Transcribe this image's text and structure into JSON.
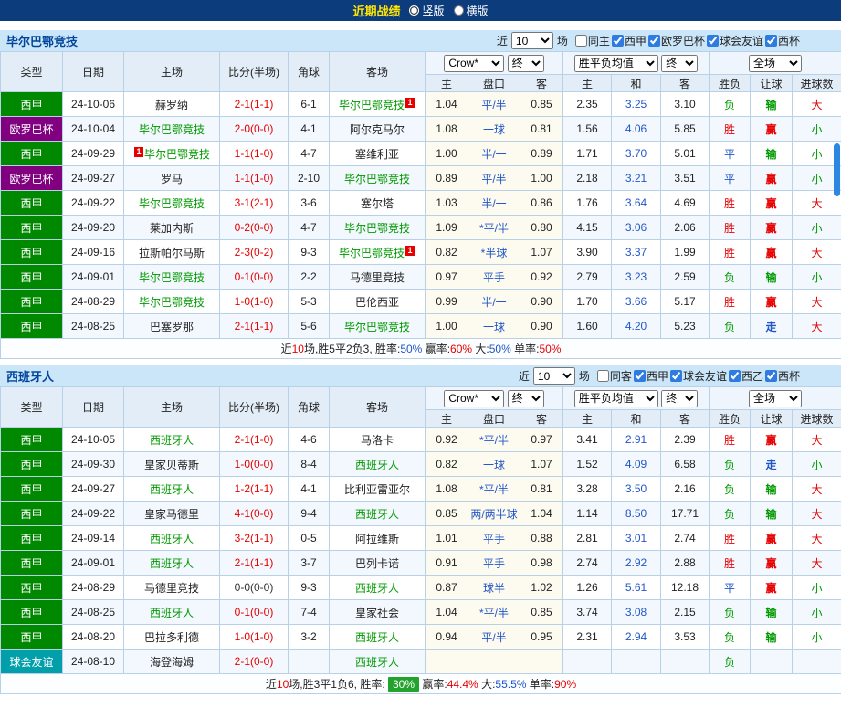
{
  "colors": {
    "topbar": "#0d3c7d",
    "section_bg": "#cbe5f9",
    "accent": "#2e7ce0",
    "red": "#e60000",
    "green": "#009900",
    "blue": "#2156c8",
    "liga": "#008800",
    "uefa": "#800080",
    "friendly": "#009faa",
    "sum_badge": "#22a32c",
    "thumb": "#2b87e0"
  },
  "topbar": {
    "title": "近期战绩",
    "options": [
      {
        "label": "竖版",
        "selected": true
      },
      {
        "label": "横版",
        "selected": false
      }
    ]
  },
  "sections": [
    {
      "team": "毕尔巴鄂竞技",
      "near": {
        "prefix": "近",
        "value": "10",
        "suffix": "场"
      },
      "filters": [
        {
          "label": "同主",
          "checked": false
        },
        {
          "label": "西甲",
          "checked": true
        },
        {
          "label": "欧罗巴杯",
          "checked": true
        },
        {
          "label": "球会友谊",
          "checked": true
        },
        {
          "label": "西杯",
          "checked": true
        }
      ],
      "selects": {
        "odds_source": "Crow*",
        "odds_period": "终",
        "wdl_source": "胜平负均值",
        "wdl_period": "终",
        "scope": "全场"
      },
      "columns": {
        "left": [
          "类型",
          "日期",
          "主场",
          "比分(半场)",
          "角球",
          "客场"
        ],
        "odds": [
          "主",
          "盘口",
          "客"
        ],
        "wdl": [
          "主",
          "和",
          "客"
        ],
        "result": [
          "胜负",
          "让球",
          "进球数"
        ]
      },
      "rows": [
        {
          "league": "西甲",
          "league_class": "liga",
          "date": "24-10-06",
          "home": "赫罗纳",
          "home_team": false,
          "score": "2-1(1-1)",
          "corners": "6-1",
          "away": "毕尔巴鄂竞技",
          "away_team": true,
          "away_badge": "1",
          "away_badge_side": "right",
          "odds_home": "1.04",
          "handicap": "平/半",
          "odds_away": "0.85",
          "avg_home": "2.35",
          "avg_draw": "3.25",
          "avg_away": "3.10",
          "result": "负",
          "result_class": "green",
          "handicap_result": "输",
          "handicap_class": "green",
          "goals": "大",
          "goals_class": "red"
        },
        {
          "league": "欧罗巴杯",
          "league_class": "uefa",
          "date": "24-10-04",
          "home": "毕尔巴鄂竞技",
          "home_team": true,
          "score": "2-0(0-0)",
          "corners": "4-1",
          "away": "阿尔克马尔",
          "away_team": false,
          "odds_home": "1.08",
          "handicap": "一球",
          "odds_away": "0.81",
          "avg_home": "1.56",
          "avg_draw": "4.06",
          "avg_away": "5.85",
          "result": "胜",
          "result_class": "red",
          "handicap_result": "赢",
          "handicap_class": "red",
          "goals": "小",
          "goals_class": "green"
        },
        {
          "league": "西甲",
          "league_class": "liga",
          "date": "24-09-29",
          "home": "毕尔巴鄂竞技",
          "home_team": true,
          "home_badge": "1",
          "home_badge_side": "left",
          "score": "1-1(1-0)",
          "corners": "4-7",
          "away": "塞维利亚",
          "away_team": false,
          "odds_home": "1.00",
          "handicap": "半/一",
          "odds_away": "0.89",
          "avg_home": "1.71",
          "avg_draw": "3.70",
          "avg_away": "5.01",
          "result": "平",
          "result_class": "blue",
          "handicap_result": "输",
          "handicap_class": "green",
          "goals": "小",
          "goals_class": "green"
        },
        {
          "league": "欧罗巴杯",
          "league_class": "uefa",
          "date": "24-09-27",
          "home": "罗马",
          "home_team": false,
          "score": "1-1(1-0)",
          "corners": "2-10",
          "away": "毕尔巴鄂竞技",
          "away_team": true,
          "odds_home": "0.89",
          "handicap": "平/半",
          "odds_away": "1.00",
          "avg_home": "2.18",
          "avg_draw": "3.21",
          "avg_away": "3.51",
          "result": "平",
          "result_class": "blue",
          "handicap_result": "赢",
          "handicap_class": "red",
          "goals": "小",
          "goals_class": "green"
        },
        {
          "league": "西甲",
          "league_class": "liga",
          "date": "24-09-22",
          "home": "毕尔巴鄂竞技",
          "home_team": true,
          "score": "3-1(2-1)",
          "corners": "3-6",
          "away": "塞尔塔",
          "away_team": false,
          "odds_home": "1.03",
          "handicap": "半/一",
          "odds_away": "0.86",
          "avg_home": "1.76",
          "avg_draw": "3.64",
          "avg_away": "4.69",
          "result": "胜",
          "result_class": "red",
          "handicap_result": "赢",
          "handicap_class": "red",
          "goals": "大",
          "goals_class": "red"
        },
        {
          "league": "西甲",
          "league_class": "liga",
          "date": "24-09-20",
          "home": "莱加内斯",
          "home_team": false,
          "score": "0-2(0-0)",
          "corners": "4-7",
          "away": "毕尔巴鄂竞技",
          "away_team": true,
          "odds_home": "1.09",
          "handicap": "*平/半",
          "odds_away": "0.80",
          "avg_home": "4.15",
          "avg_draw": "3.06",
          "avg_away": "2.06",
          "result": "胜",
          "result_class": "red",
          "handicap_result": "赢",
          "handicap_class": "red",
          "goals": "小",
          "goals_class": "green"
        },
        {
          "league": "西甲",
          "league_class": "liga",
          "date": "24-09-16",
          "home": "拉斯帕尔马斯",
          "home_team": false,
          "score": "2-3(0-2)",
          "corners": "9-3",
          "away": "毕尔巴鄂竞技",
          "away_team": true,
          "away_badge": "1",
          "away_badge_side": "right",
          "odds_home": "0.82",
          "handicap": "*半球",
          "odds_away": "1.07",
          "avg_home": "3.90",
          "avg_draw": "3.37",
          "avg_away": "1.99",
          "result": "胜",
          "result_class": "red",
          "handicap_result": "赢",
          "handicap_class": "red",
          "goals": "大",
          "goals_class": "red"
        },
        {
          "league": "西甲",
          "league_class": "liga",
          "date": "24-09-01",
          "home": "毕尔巴鄂竞技",
          "home_team": true,
          "score": "0-1(0-0)",
          "corners": "2-2",
          "away": "马德里竞技",
          "away_team": false,
          "odds_home": "0.97",
          "handicap": "平手",
          "odds_away": "0.92",
          "avg_home": "2.79",
          "avg_draw": "3.23",
          "avg_away": "2.59",
          "result": "负",
          "result_class": "green",
          "handicap_result": "输",
          "handicap_class": "green",
          "goals": "小",
          "goals_class": "green"
        },
        {
          "league": "西甲",
          "league_class": "liga",
          "date": "24-08-29",
          "home": "毕尔巴鄂竞技",
          "home_team": true,
          "score": "1-0(1-0)",
          "corners": "5-3",
          "away": "巴伦西亚",
          "away_team": false,
          "odds_home": "0.99",
          "handicap": "半/一",
          "odds_away": "0.90",
          "avg_home": "1.70",
          "avg_draw": "3.66",
          "avg_away": "5.17",
          "result": "胜",
          "result_class": "red",
          "handicap_result": "赢",
          "handicap_class": "red",
          "goals": "大",
          "goals_class": "red"
        },
        {
          "league": "西甲",
          "league_class": "liga",
          "date": "24-08-25",
          "home": "巴塞罗那",
          "home_team": false,
          "score": "2-1(1-1)",
          "corners": "5-6",
          "away": "毕尔巴鄂竞技",
          "away_team": true,
          "odds_home": "1.00",
          "handicap": "一球",
          "odds_away": "0.90",
          "avg_home": "1.60",
          "avg_draw": "4.20",
          "avg_away": "5.23",
          "result": "负",
          "result_class": "green",
          "handicap_result": "走",
          "handicap_class": "blue",
          "goals": "大",
          "goals_class": "red"
        }
      ],
      "summary": [
        {
          "t": "近"
        },
        {
          "t": "10",
          "c": "red"
        },
        {
          "t": "场,胜5平2负3, 胜率:"
        },
        {
          "t": "50%",
          "c": "blue"
        },
        {
          "t": " 赢率:"
        },
        {
          "t": "60%",
          "c": "red"
        },
        {
          "t": " 大:"
        },
        {
          "t": "50%",
          "c": "blue"
        },
        {
          "t": " 单率:"
        },
        {
          "t": "50%",
          "c": "red"
        }
      ]
    },
    {
      "team": "西班牙人",
      "near": {
        "prefix": "近",
        "value": "10",
        "suffix": "场"
      },
      "filters": [
        {
          "label": "同客",
          "checked": false
        },
        {
          "label": "西甲",
          "checked": true
        },
        {
          "label": "球会友谊",
          "checked": true
        },
        {
          "label": "西乙",
          "checked": true
        },
        {
          "label": "西杯",
          "checked": true
        }
      ],
      "selects": {
        "odds_source": "Crow*",
        "odds_period": "终",
        "wdl_source": "胜平负均值",
        "wdl_period": "终",
        "scope": "全场"
      },
      "columns": {
        "left": [
          "类型",
          "日期",
          "主场",
          "比分(半场)",
          "角球",
          "客场"
        ],
        "odds": [
          "主",
          "盘口",
          "客"
        ],
        "wdl": [
          "主",
          "和",
          "客"
        ],
        "result": [
          "胜负",
          "让球",
          "进球数"
        ]
      },
      "rows": [
        {
          "league": "西甲",
          "league_class": "liga",
          "date": "24-10-05",
          "home": "西班牙人",
          "home_team": true,
          "score": "2-1(1-0)",
          "corners": "4-6",
          "away": "马洛卡",
          "away_team": false,
          "odds_home": "0.92",
          "handicap": "*平/半",
          "odds_away": "0.97",
          "avg_home": "3.41",
          "avg_draw": "2.91",
          "avg_away": "2.39",
          "result": "胜",
          "result_class": "red",
          "handicap_result": "赢",
          "handicap_class": "red",
          "goals": "大",
          "goals_class": "red"
        },
        {
          "league": "西甲",
          "league_class": "liga",
          "date": "24-09-30",
          "home": "皇家贝蒂斯",
          "home_team": false,
          "score": "1-0(0-0)",
          "corners": "8-4",
          "away": "西班牙人",
          "away_team": true,
          "odds_home": "0.82",
          "handicap": "一球",
          "odds_away": "1.07",
          "avg_home": "1.52",
          "avg_draw": "4.09",
          "avg_away": "6.58",
          "result": "负",
          "result_class": "green",
          "handicap_result": "走",
          "handicap_class": "blue",
          "goals": "小",
          "goals_class": "green"
        },
        {
          "league": "西甲",
          "league_class": "liga",
          "date": "24-09-27",
          "home": "西班牙人",
          "home_team": true,
          "score": "1-2(1-1)",
          "corners": "4-1",
          "away": "比利亚雷亚尔",
          "away_team": false,
          "odds_home": "1.08",
          "handicap": "*平/半",
          "odds_away": "0.81",
          "avg_home": "3.28",
          "avg_draw": "3.50",
          "avg_away": "2.16",
          "result": "负",
          "result_class": "green",
          "handicap_result": "输",
          "handicap_class": "green",
          "goals": "大",
          "goals_class": "red"
        },
        {
          "league": "西甲",
          "league_class": "liga",
          "date": "24-09-22",
          "home": "皇家马德里",
          "home_team": false,
          "score": "4-1(0-0)",
          "corners": "9-4",
          "away": "西班牙人",
          "away_team": true,
          "odds_home": "0.85",
          "handicap": "两/两半球",
          "odds_away": "1.04",
          "avg_home": "1.14",
          "avg_draw": "8.50",
          "avg_away": "17.71",
          "result": "负",
          "result_class": "green",
          "handicap_result": "输",
          "handicap_class": "green",
          "goals": "大",
          "goals_class": "red"
        },
        {
          "league": "西甲",
          "league_class": "liga",
          "date": "24-09-14",
          "home": "西班牙人",
          "home_team": true,
          "score": "3-2(1-1)",
          "corners": "0-5",
          "away": "阿拉维斯",
          "away_team": false,
          "odds_home": "1.01",
          "handicap": "平手",
          "odds_away": "0.88",
          "avg_home": "2.81",
          "avg_draw": "3.01",
          "avg_away": "2.74",
          "result": "胜",
          "result_class": "red",
          "handicap_result": "赢",
          "handicap_class": "red",
          "goals": "大",
          "goals_class": "red"
        },
        {
          "league": "西甲",
          "league_class": "liga",
          "date": "24-09-01",
          "home": "西班牙人",
          "home_team": true,
          "score": "2-1(1-1)",
          "corners": "3-7",
          "away": "巴列卡诺",
          "away_team": false,
          "odds_home": "0.91",
          "handicap": "平手",
          "odds_away": "0.98",
          "avg_home": "2.74",
          "avg_draw": "2.92",
          "avg_away": "2.88",
          "result": "胜",
          "result_class": "red",
          "handicap_result": "赢",
          "handicap_class": "red",
          "goals": "大",
          "goals_class": "red"
        },
        {
          "league": "西甲",
          "league_class": "liga",
          "date": "24-08-29",
          "home": "马德里竞技",
          "home_team": false,
          "score": "0-0(0-0)",
          "score_dark": true,
          "corners": "9-3",
          "away": "西班牙人",
          "away_team": true,
          "odds_home": "0.87",
          "handicap": "球半",
          "odds_away": "1.02",
          "avg_home": "1.26",
          "avg_draw": "5.61",
          "avg_away": "12.18",
          "result": "平",
          "result_class": "blue",
          "handicap_result": "赢",
          "handicap_class": "red",
          "goals": "小",
          "goals_class": "green"
        },
        {
          "league": "西甲",
          "league_class": "liga",
          "date": "24-08-25",
          "home": "西班牙人",
          "home_team": true,
          "score": "0-1(0-0)",
          "corners": "7-4",
          "away": "皇家社会",
          "away_team": false,
          "odds_home": "1.04",
          "handicap": "*平/半",
          "odds_away": "0.85",
          "avg_home": "3.74",
          "avg_draw": "3.08",
          "avg_away": "2.15",
          "result": "负",
          "result_class": "green",
          "handicap_result": "输",
          "handicap_class": "green",
          "goals": "小",
          "goals_class": "green"
        },
        {
          "league": "西甲",
          "league_class": "liga",
          "date": "24-08-20",
          "home": "巴拉多利德",
          "home_team": false,
          "score": "1-0(1-0)",
          "corners": "3-2",
          "away": "西班牙人",
          "away_team": true,
          "odds_home": "0.94",
          "handicap": "平/半",
          "odds_away": "0.95",
          "avg_home": "2.31",
          "avg_draw": "2.94",
          "avg_away": "3.53",
          "result": "负",
          "result_class": "green",
          "handicap_result": "输",
          "handicap_class": "green",
          "goals": "小",
          "goals_class": "green"
        },
        {
          "league": "球会友谊",
          "league_class": "friendly",
          "date": "24-08-10",
          "home": "海登海姆",
          "home_team": false,
          "score": "2-1(0-0)",
          "corners": "",
          "away": "西班牙人",
          "away_team": true,
          "odds_home": "",
          "handicap": "",
          "odds_away": "",
          "avg_home": "",
          "avg_draw": "",
          "avg_away": "",
          "result": "负",
          "result_class": "green",
          "handicap_result": "",
          "handicap_class": "",
          "goals": "",
          "goals_class": ""
        }
      ],
      "summary": [
        {
          "t": "近"
        },
        {
          "t": "10",
          "c": "red"
        },
        {
          "t": "场,胜3平1负6, 胜率: "
        },
        {
          "t": "30%",
          "badge": true
        },
        {
          "t": " 赢率:"
        },
        {
          "t": "44.4%",
          "c": "red"
        },
        {
          "t": " 大:"
        },
        {
          "t": "55.5%",
          "c": "blue"
        },
        {
          "t": " 单率:"
        },
        {
          "t": "90%",
          "c": "red"
        }
      ]
    }
  ]
}
